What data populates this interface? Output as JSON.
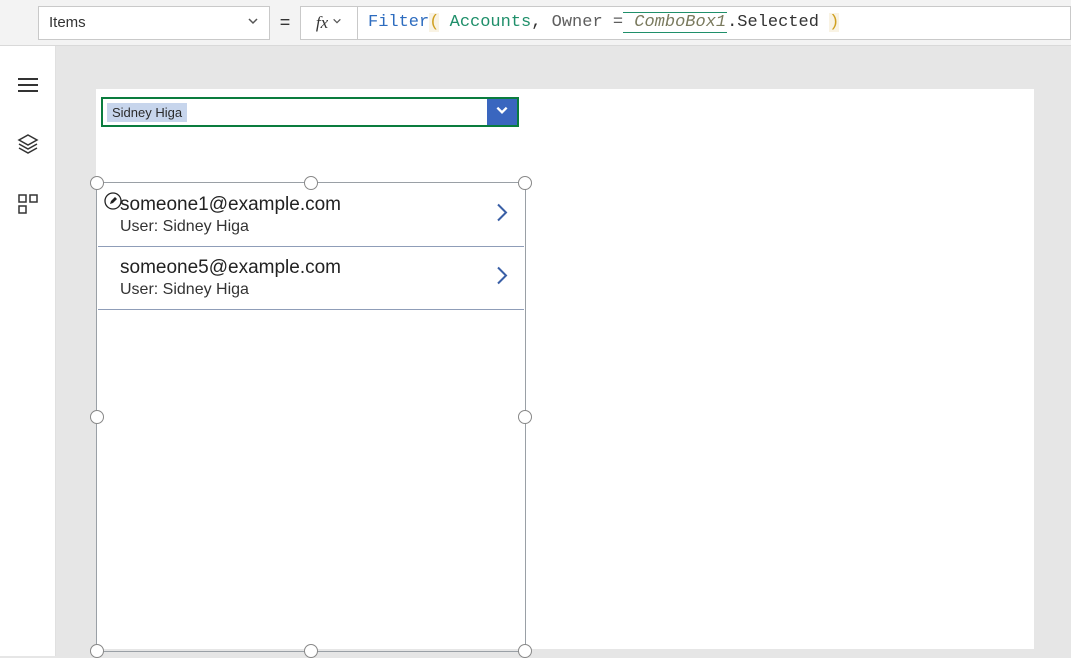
{
  "topbar": {
    "property": "Items",
    "equals": "=",
    "fx_label": "fx",
    "formula": {
      "fn": "Filter",
      "paren_open": "(",
      "arg1": " Accounts",
      "comma": ",",
      "field": " Owner ",
      "eq": "=",
      "ref": " ComboBox1",
      "prop": ".Selected ",
      "paren_close": ")"
    }
  },
  "sidebar": {
    "icons": {
      "tree": "tree-view-icon",
      "layers": "layers-icon",
      "components": "components-icon"
    }
  },
  "combobox": {
    "selected": "Sidney Higa"
  },
  "gallery": {
    "items": [
      {
        "email": "someone1@example.com",
        "sub": "User: Sidney Higa",
        "show_edit": true
      },
      {
        "email": "someone5@example.com",
        "sub": "User: Sidney Higa",
        "show_edit": false
      }
    ]
  }
}
